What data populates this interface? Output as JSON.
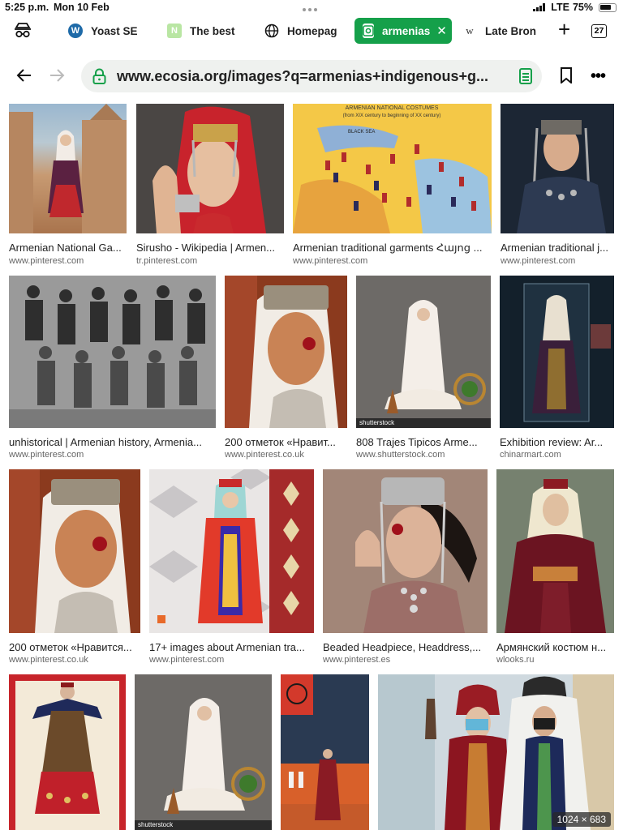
{
  "status": {
    "time": "5:25 p.m.",
    "date": "Mon 10 Feb",
    "carrier": "LTE",
    "battery": "75%"
  },
  "tabs": [
    {
      "label": "Yoast SE",
      "icon": "wordpress-icon"
    },
    {
      "label": "The best",
      "icon": "n-icon"
    },
    {
      "label": "Homepag",
      "icon": "globe-icon"
    },
    {
      "label": "armenias",
      "icon": "ecosia-images-icon",
      "active": true
    },
    {
      "label": "Late Bron",
      "icon": "wikipedia-icon"
    }
  ],
  "tab_count": "27",
  "url": "www.ecosia.org/images?q=armenias+indigenous+g...",
  "accent_color": "#15a04a",
  "results": [
    {
      "title": "Armenian National Ga...",
      "source": "www.pinterest.com"
    },
    {
      "title": "Sirusho - Wikipedia | Armen...",
      "source": "tr.pinterest.com"
    },
    {
      "title": "Armenian traditional garments Հայոց ...",
      "source": "www.pinterest.com",
      "map_title": "ARMENIAN NATIONAL COSTUMES",
      "map_subtitle": "(from XIX century to beginning of XX century)",
      "map_label": "BLACK SEA"
    },
    {
      "title": "Armenian traditional j...",
      "source": "www.pinterest.com"
    },
    {
      "title": "unhistorical | Armenian history, Armenia...",
      "source": "www.pinterest.com"
    },
    {
      "title": "200 отметок «Нравит...",
      "source": "www.pinterest.co.uk"
    },
    {
      "title": "808 Trajes Tipicos Arme...",
      "source": "www.shutterstock.com",
      "watermark": "shutterstock"
    },
    {
      "title": "Exhibition review: Ar...",
      "source": "chinarmart.com"
    },
    {
      "title": "200 отметок «Нравится...",
      "source": "www.pinterest.co.uk"
    },
    {
      "title": "17+ images about Armenian tra...",
      "source": "www.pinterest.com"
    },
    {
      "title": "Beaded Headpiece, Headdress,...",
      "source": "www.pinterest.es"
    },
    {
      "title": "Армянский костюм н...",
      "source": "wlooks.ru"
    },
    {
      "title": "",
      "source": ""
    },
    {
      "title": "",
      "source": "",
      "watermark": "shutterstock"
    },
    {
      "title": "",
      "source": ""
    },
    {
      "title": "",
      "source": "",
      "dimensions": "1024 × 683"
    }
  ]
}
